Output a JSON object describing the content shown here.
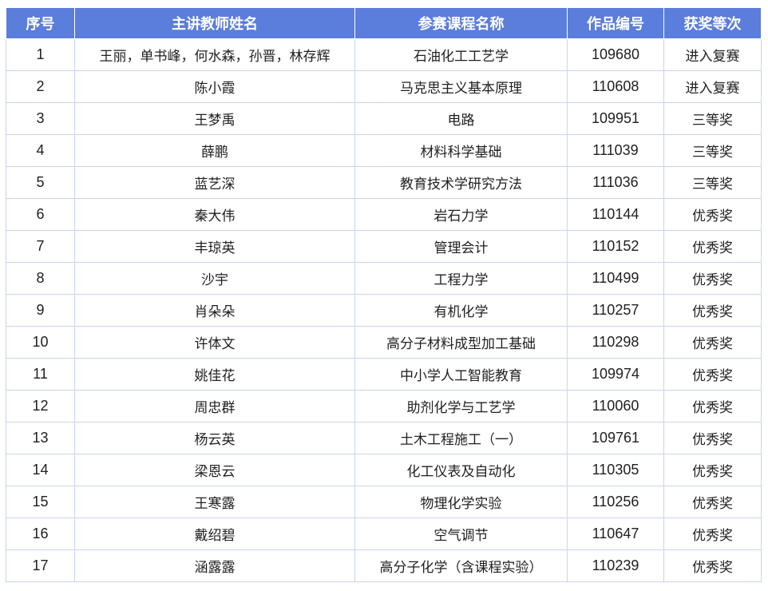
{
  "table": {
    "headers": {
      "index": "序号",
      "teacher": "主讲教师姓名",
      "course": "参赛课程名称",
      "work_id": "作品编号",
      "award": "获奖等次"
    },
    "rows": [
      {
        "index": "1",
        "teacher": "王丽，单书峰，何水森，孙晋，林存辉",
        "course": "石油化工工艺学",
        "work_id": "109680",
        "award": "进入复赛"
      },
      {
        "index": "2",
        "teacher": "陈小霞",
        "course": "马克思主义基本原理",
        "work_id": "110608",
        "award": "进入复赛"
      },
      {
        "index": "3",
        "teacher": "王梦禹",
        "course": "电路",
        "work_id": "109951",
        "award": "三等奖"
      },
      {
        "index": "4",
        "teacher": "薛鹏",
        "course": "材料科学基础",
        "work_id": "111039",
        "award": "三等奖"
      },
      {
        "index": "5",
        "teacher": "蓝艺深",
        "course": "教育技术学研究方法",
        "work_id": "111036",
        "award": "三等奖"
      },
      {
        "index": "6",
        "teacher": "秦大伟",
        "course": "岩石力学",
        "work_id": "110144",
        "award": "优秀奖"
      },
      {
        "index": "7",
        "teacher": "丰琼英",
        "course": "管理会计",
        "work_id": "110152",
        "award": "优秀奖"
      },
      {
        "index": "8",
        "teacher": "沙宇",
        "course": "工程力学",
        "work_id": "110499",
        "award": "优秀奖"
      },
      {
        "index": "9",
        "teacher": "肖朵朵",
        "course": "有机化学",
        "work_id": "110257",
        "award": "优秀奖"
      },
      {
        "index": "10",
        "teacher": "许体文",
        "course": "高分子材料成型加工基础",
        "work_id": "110298",
        "award": "优秀奖"
      },
      {
        "index": "11",
        "teacher": "姚佳花",
        "course": "中小学人工智能教育",
        "work_id": "109974",
        "award": "优秀奖"
      },
      {
        "index": "12",
        "teacher": "周忠群",
        "course": "助剂化学与工艺学",
        "work_id": "110060",
        "award": "优秀奖"
      },
      {
        "index": "13",
        "teacher": "杨云英",
        "course": "土木工程施工（一）",
        "work_id": "109761",
        "award": "优秀奖"
      },
      {
        "index": "14",
        "teacher": "梁恩云",
        "course": "化工仪表及自动化",
        "work_id": "110305",
        "award": "优秀奖"
      },
      {
        "index": "15",
        "teacher": "王寒露",
        "course": "物理化学实验",
        "work_id": "110256",
        "award": "优秀奖"
      },
      {
        "index": "16",
        "teacher": "戴绍碧",
        "course": "空气调节",
        "work_id": "110647",
        "award": "优秀奖"
      },
      {
        "index": "17",
        "teacher": "涵露露",
        "course": "高分子化学（含课程实验）",
        "work_id": "110239",
        "award": "优秀奖"
      }
    ]
  }
}
